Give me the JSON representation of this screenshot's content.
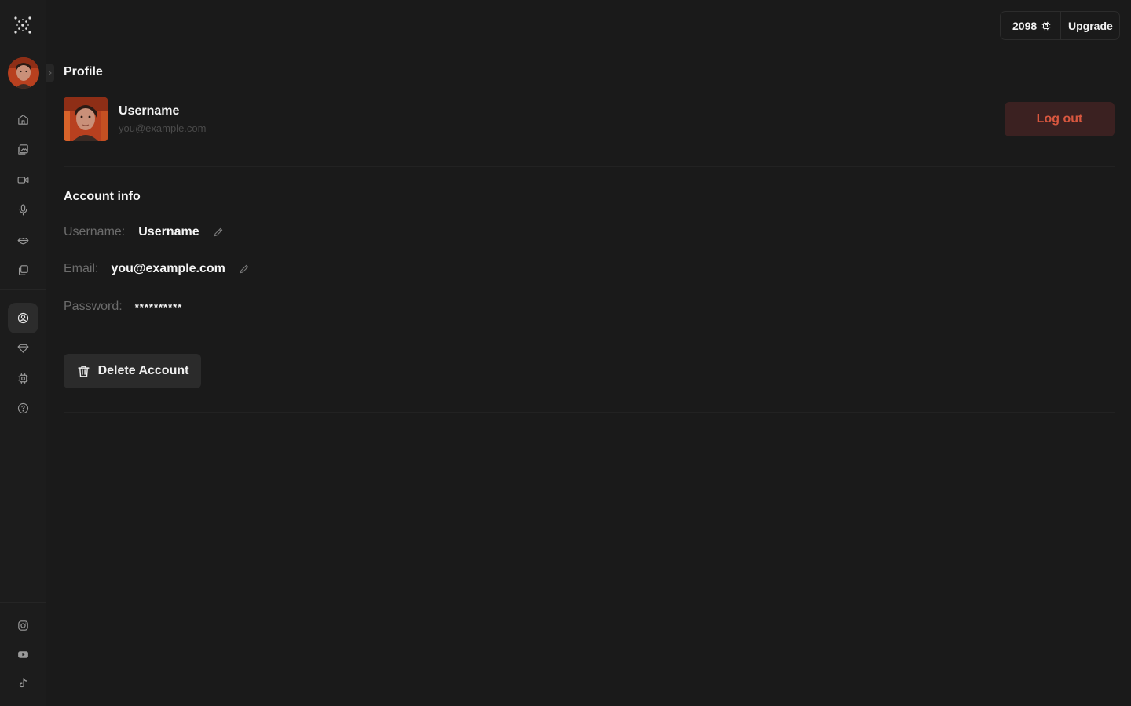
{
  "header": {
    "credits": "2098",
    "upgrade_label": "Upgrade"
  },
  "sidebar": {
    "nav": [
      {
        "icon": "home-icon"
      },
      {
        "icon": "gallery-icon"
      },
      {
        "icon": "video-icon"
      },
      {
        "icon": "microphone-icon"
      },
      {
        "icon": "lips-icon"
      },
      {
        "icon": "layers-icon"
      }
    ],
    "account_nav": [
      {
        "icon": "user-circle-icon",
        "active": true
      },
      {
        "icon": "diamond-icon"
      },
      {
        "icon": "chip-icon"
      },
      {
        "icon": "help-icon"
      }
    ],
    "social": [
      {
        "icon": "instagram-icon"
      },
      {
        "icon": "youtube-icon"
      },
      {
        "icon": "tiktok-icon"
      }
    ]
  },
  "profile": {
    "title": "Profile",
    "name": "Username",
    "email": "you@example.com",
    "logout_label": "Log out"
  },
  "account": {
    "title": "Account info",
    "username_label": "Username:",
    "username_value": "Username",
    "email_label": "Email:",
    "email_value": "you@example.com",
    "password_label": "Password:",
    "password_value": "**********",
    "delete_label": "Delete Account"
  },
  "colors": {
    "background": "#1a1a1a",
    "logout_bg": "#3b2121",
    "logout_text": "#d8573f",
    "muted_label": "#6c6c6c"
  }
}
